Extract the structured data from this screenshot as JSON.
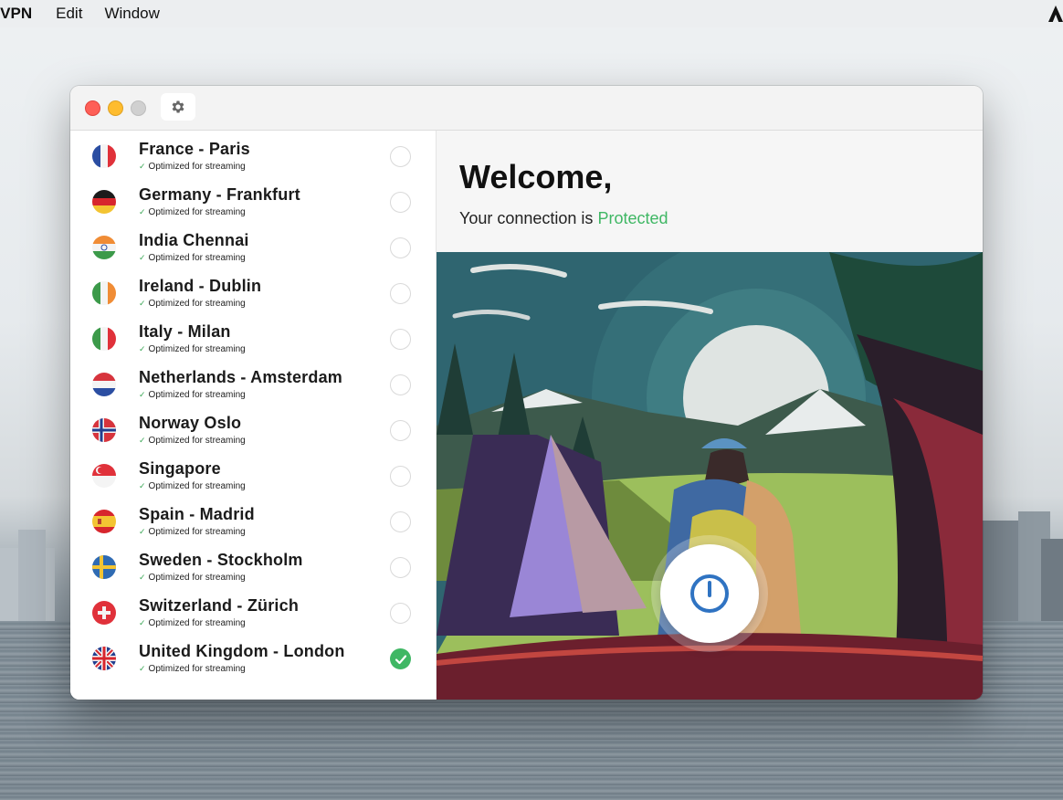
{
  "menubar": {
    "app_name": "s VPN",
    "items": [
      "Edit",
      "Window"
    ]
  },
  "window": {
    "settings_icon": "gear-icon"
  },
  "servers": [
    {
      "name": "France - Paris",
      "subtitle": "Optimized for streaming",
      "flag": "france",
      "selected": false
    },
    {
      "name": "Germany - Frankfurt",
      "subtitle": "Optimized for streaming",
      "flag": "germany",
      "selected": false
    },
    {
      "name": "India Chennai",
      "subtitle": "Optimized for streaming",
      "flag": "india",
      "selected": false
    },
    {
      "name": "Ireland - Dublin",
      "subtitle": "Optimized for streaming",
      "flag": "ireland",
      "selected": false
    },
    {
      "name": "Italy - Milan",
      "subtitle": "Optimized for streaming",
      "flag": "italy",
      "selected": false
    },
    {
      "name": "Netherlands - Amsterdam",
      "subtitle": "Optimized for streaming",
      "flag": "netherlands",
      "selected": false
    },
    {
      "name": "Norway Oslo",
      "subtitle": "Optimized for streaming",
      "flag": "norway",
      "selected": false
    },
    {
      "name": "Singapore",
      "subtitle": "Optimized for streaming",
      "flag": "singapore",
      "selected": false
    },
    {
      "name": "Spain - Madrid",
      "subtitle": "Optimized for streaming",
      "flag": "spain",
      "selected": false
    },
    {
      "name": "Sweden - Stockholm",
      "subtitle": "Optimized for streaming",
      "flag": "sweden",
      "selected": false
    },
    {
      "name": "Switzerland - Zürich",
      "subtitle": "Optimized for streaming",
      "flag": "switzerland",
      "selected": false
    },
    {
      "name": "United Kingdom - London",
      "subtitle": "Optimized for streaming",
      "flag": "uk",
      "selected": true
    }
  ],
  "main": {
    "welcome": "Welcome,",
    "status_prefix": "Your connection is",
    "status_word": "Protected",
    "status_color": "#3fb764",
    "power_icon": "power-icon"
  }
}
